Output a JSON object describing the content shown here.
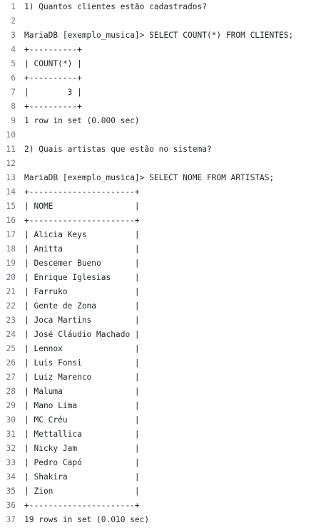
{
  "code": {
    "lines": [
      {
        "num": "1",
        "text": "1) Quantos clientes estão cadastrados?"
      },
      {
        "num": "2",
        "text": ""
      },
      {
        "num": "3",
        "text": "MariaDB [exemplo_musica]> SELECT COUNT(*) FROM CLIENTES;"
      },
      {
        "num": "4",
        "text": "+----------+"
      },
      {
        "num": "5",
        "text": "| COUNT(*) |"
      },
      {
        "num": "6",
        "text": "+----------+"
      },
      {
        "num": "7",
        "text": "|        3 |"
      },
      {
        "num": "8",
        "text": "+----------+"
      },
      {
        "num": "9",
        "text": "1 row in set (0.000 sec)"
      },
      {
        "num": "10",
        "text": ""
      },
      {
        "num": "11",
        "text": "2) Quais artistas que estão no sistema?"
      },
      {
        "num": "12",
        "text": ""
      },
      {
        "num": "13",
        "text": "MariaDB [exemplo_musica]> SELECT NOME FROM ARTISTAS;"
      },
      {
        "num": "14",
        "text": "+----------------------+"
      },
      {
        "num": "15",
        "text": "| NOME                 |"
      },
      {
        "num": "16",
        "text": "+----------------------+"
      },
      {
        "num": "17",
        "text": "| Alicia Keys          |"
      },
      {
        "num": "18",
        "text": "| Anitta               |"
      },
      {
        "num": "19",
        "text": "| Descemer Bueno       |"
      },
      {
        "num": "20",
        "text": "| Enrique Iglesias     |"
      },
      {
        "num": "21",
        "text": "| Farruko              |"
      },
      {
        "num": "22",
        "text": "| Gente de Zona        |"
      },
      {
        "num": "23",
        "text": "| Joca Martins         |"
      },
      {
        "num": "24",
        "text": "| José Cláudio Machado |"
      },
      {
        "num": "25",
        "text": "| Lennox               |"
      },
      {
        "num": "26",
        "text": "| Luis Fonsi           |"
      },
      {
        "num": "27",
        "text": "| Luiz Marenco         |"
      },
      {
        "num": "28",
        "text": "| Maluma               |"
      },
      {
        "num": "29",
        "text": "| Mano Lima            |"
      },
      {
        "num": "30",
        "text": "| MC Créu              |"
      },
      {
        "num": "31",
        "text": "| Mettallica           |"
      },
      {
        "num": "32",
        "text": "| Nicky Jam            |"
      },
      {
        "num": "33",
        "text": "| Pedro Capó           |"
      },
      {
        "num": "34",
        "text": "| Shakira              |"
      },
      {
        "num": "35",
        "text": "| Zion                 |"
      },
      {
        "num": "36",
        "text": "+----------------------+"
      },
      {
        "num": "37",
        "text": "19 rows in set (0.010 sec)"
      }
    ]
  }
}
